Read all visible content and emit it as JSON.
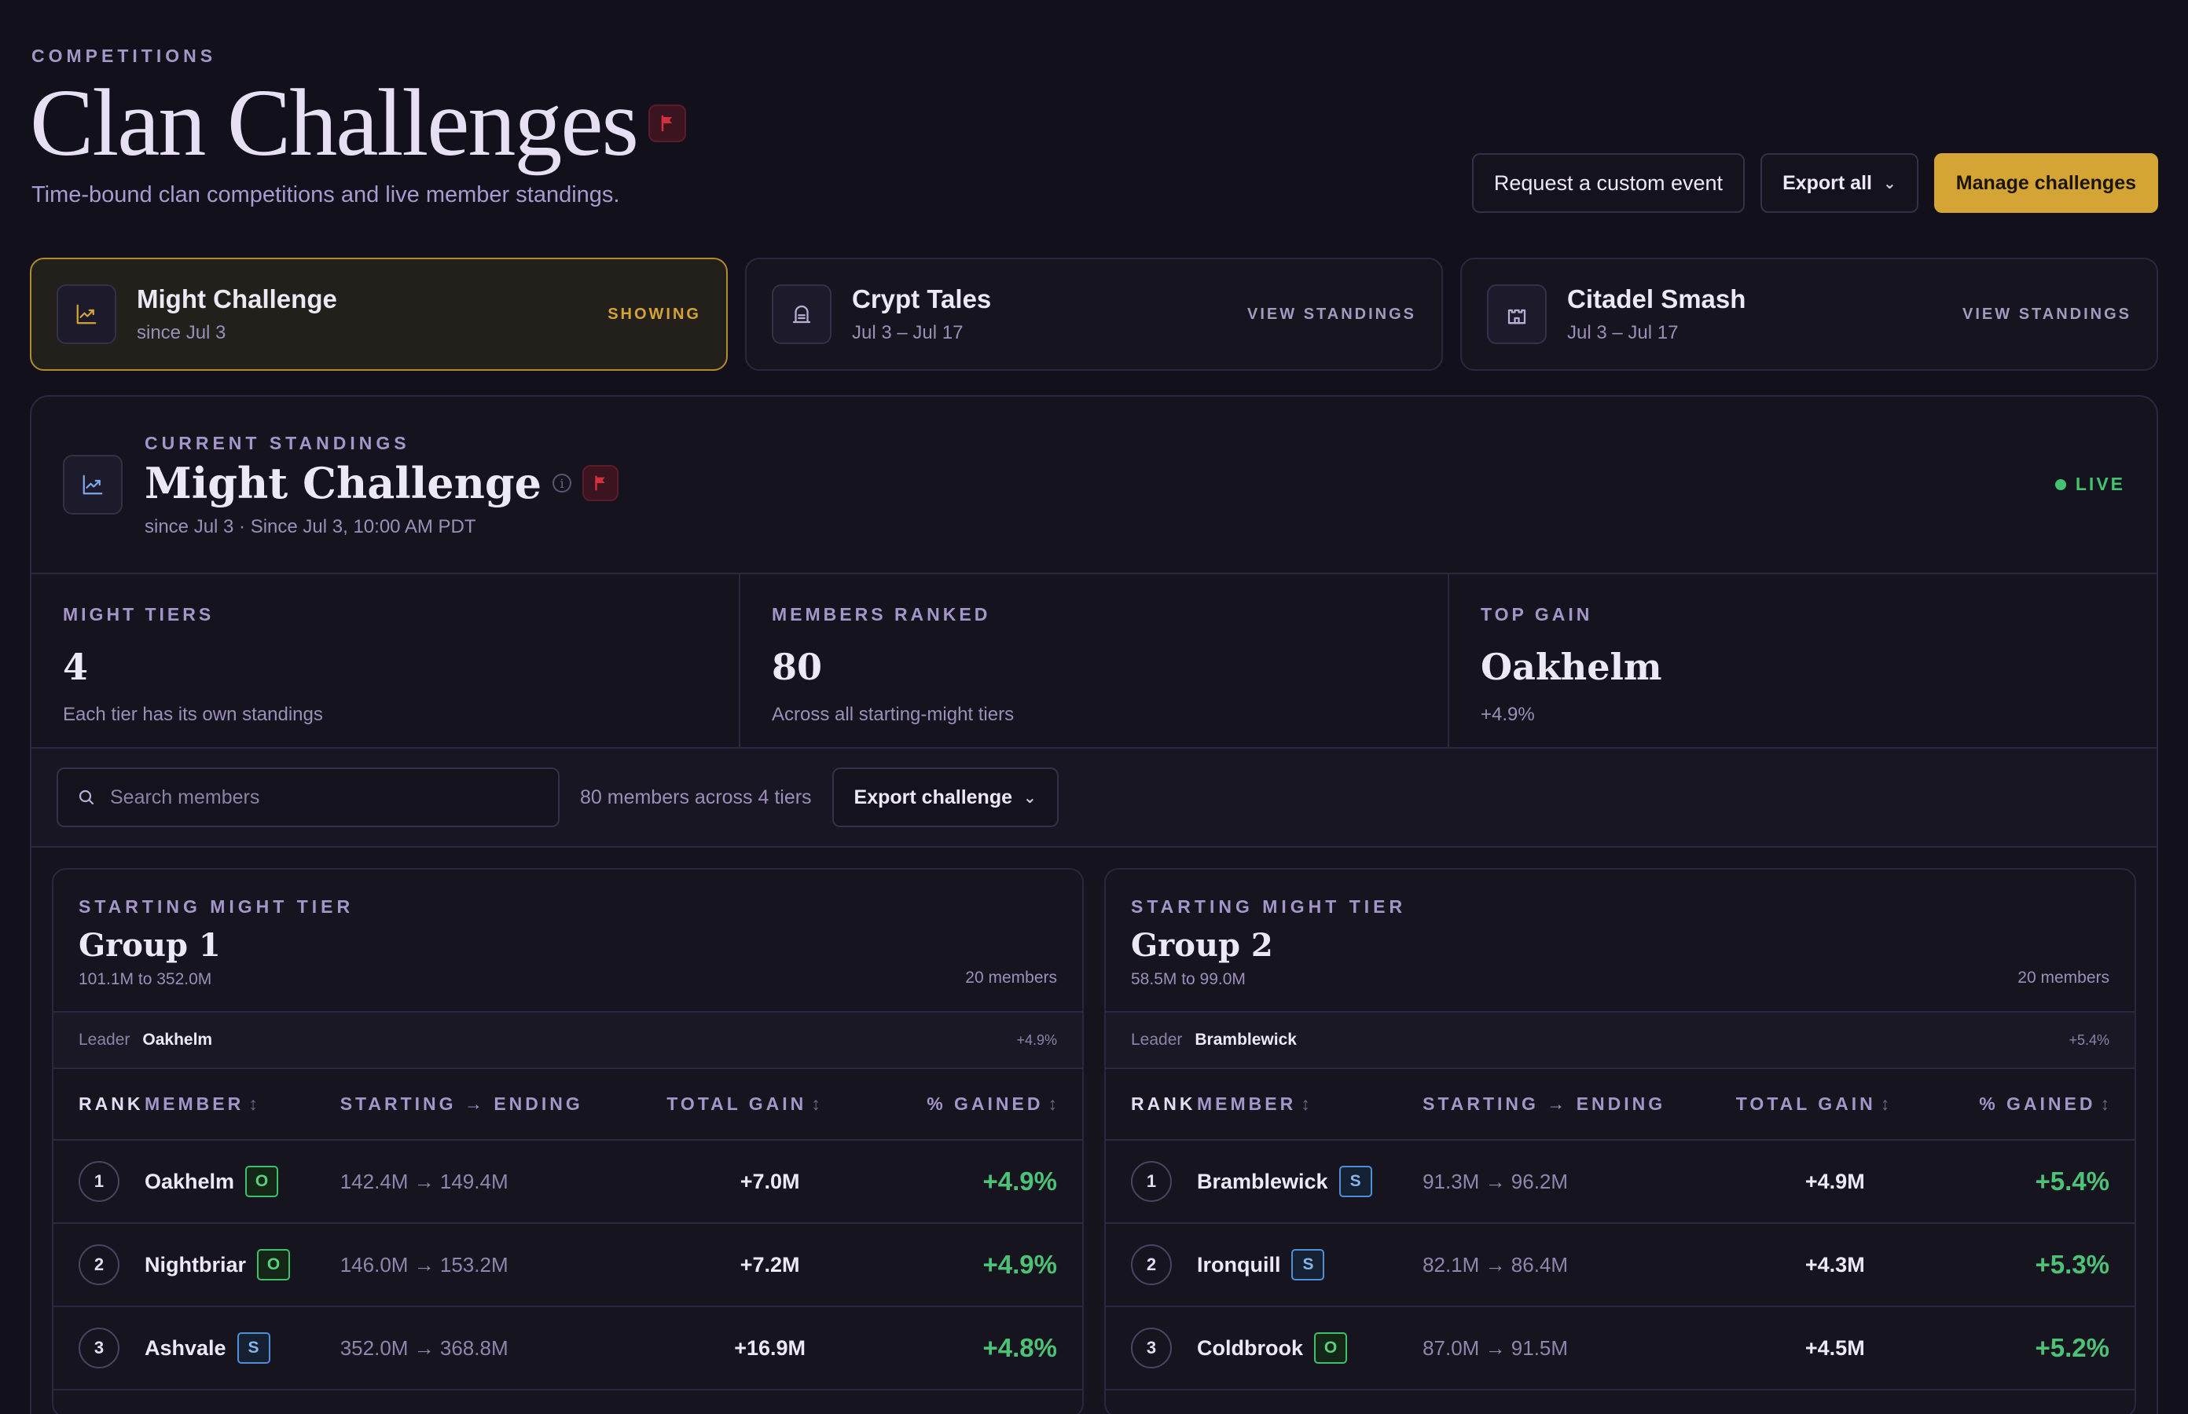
{
  "header": {
    "eyebrow": "COMPETITIONS",
    "title": "Clan Challenges",
    "subtitle": "Time-bound clan competitions and live member standings.",
    "actions": {
      "request": "Request a custom event",
      "export": "Export all",
      "manage": "Manage challenges"
    }
  },
  "challenges": [
    {
      "name": "Might Challenge",
      "date": "since Jul 3",
      "action": "SHOWING",
      "icon": "chart-trend-icon"
    },
    {
      "name": "Crypt Tales",
      "date": "Jul 3 – Jul 17",
      "action": "VIEW STANDINGS",
      "icon": "tombstone-icon"
    },
    {
      "name": "Citadel Smash",
      "date": "Jul 3 – Jul 17",
      "action": "VIEW STANDINGS",
      "icon": "castle-icon"
    }
  ],
  "standings": {
    "eyebrow": "CURRENT STANDINGS",
    "title": "Might Challenge",
    "subtitle": "since Jul 3 · Since Jul 3, 10:00 AM PDT",
    "status": "LIVE"
  },
  "stats": [
    {
      "label": "MIGHT TIERS",
      "value": "4",
      "hint": "Each tier has its own standings"
    },
    {
      "label": "MEMBERS RANKED",
      "value": "80",
      "hint": "Across all starting-might tiers"
    },
    {
      "label": "TOP GAIN",
      "value": "Oakhelm",
      "hint": "+4.9%"
    }
  ],
  "toolbar": {
    "search_placeholder": "Search members",
    "count_text": "80 members across 4 tiers",
    "export_label": "Export challenge"
  },
  "table_headers": {
    "rank": "RANK",
    "member": "MEMBER",
    "start_end": "STARTING → ENDING",
    "total_gain": "TOTAL GAIN",
    "pct_gained": "% GAINED",
    "sort_glyph": "↕"
  },
  "groups": [
    {
      "eyebrow": "STARTING MIGHT TIER",
      "title": "Group 1",
      "range": "101.1M to 352.0M",
      "count": "20 members",
      "leader_label": "Leader",
      "leader": "Oakhelm",
      "leader_pct": "+4.9%",
      "rows": [
        {
          "rank": "1",
          "member": "Oakhelm",
          "tag": "O",
          "start_end": "142.4M → 149.4M",
          "gain": "+7.0M",
          "pct": "+4.9%"
        },
        {
          "rank": "2",
          "member": "Nightbriar",
          "tag": "O",
          "start_end": "146.0M → 153.2M",
          "gain": "+7.2M",
          "pct": "+4.9%"
        },
        {
          "rank": "3",
          "member": "Ashvale",
          "tag": "S",
          "start_end": "352.0M → 368.8M",
          "gain": "+16.9M",
          "pct": "+4.8%"
        }
      ]
    },
    {
      "eyebrow": "STARTING MIGHT TIER",
      "title": "Group 2",
      "range": "58.5M to 99.0M",
      "count": "20 members",
      "leader_label": "Leader",
      "leader": "Bramblewick",
      "leader_pct": "+5.4%",
      "rows": [
        {
          "rank": "1",
          "member": "Bramblewick",
          "tag": "S",
          "start_end": "91.3M → 96.2M",
          "gain": "+4.9M",
          "pct": "+5.4%"
        },
        {
          "rank": "2",
          "member": "Ironquill",
          "tag": "S",
          "start_end": "82.1M → 86.4M",
          "gain": "+4.3M",
          "pct": "+5.3%"
        },
        {
          "rank": "3",
          "member": "Coldbrook",
          "tag": "O",
          "start_end": "87.0M → 91.5M",
          "gain": "+4.5M",
          "pct": "+5.2%"
        }
      ]
    }
  ],
  "colors": {
    "accent_gold": "#d4a534",
    "live_green": "#43c371",
    "gain_green": "#4cc276",
    "flag_red": "#d0313c"
  }
}
